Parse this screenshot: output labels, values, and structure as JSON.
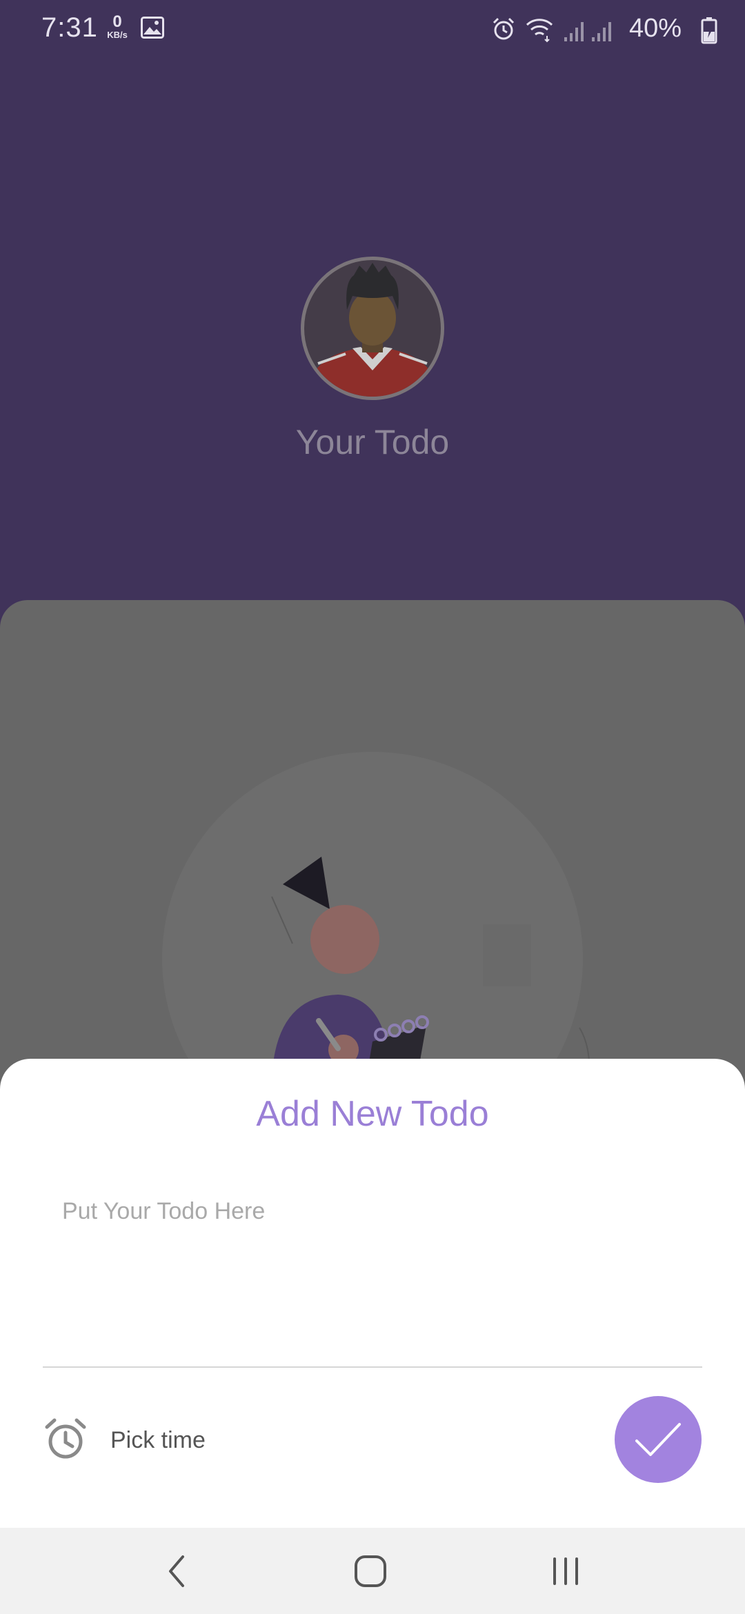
{
  "status_bar": {
    "time": "7:31",
    "network_speed": "0",
    "network_unit": "KB/s",
    "battery": "40%",
    "icons": [
      "gallery-icon",
      "alarm-icon",
      "wifi-icon",
      "signal-icon",
      "signal-icon",
      "battery-charging-icon"
    ]
  },
  "header": {
    "avatar_icon": "user-avatar",
    "title": "Your Todo"
  },
  "sheet": {
    "title": "Add New Todo",
    "todo_placeholder": "Put Your Todo Here",
    "todo_value": "",
    "pick_time_icon": "alarm-clock-icon",
    "pick_time_label": "Pick time",
    "confirm_icon": "check-icon"
  },
  "nav_bar": {
    "icons": [
      "back-icon",
      "home-icon",
      "recents-icon"
    ]
  },
  "colors": {
    "header_bg": "#40335a",
    "accent": "#a283df",
    "title_purple": "#9a7fd6",
    "overlay_card": "#676767"
  }
}
